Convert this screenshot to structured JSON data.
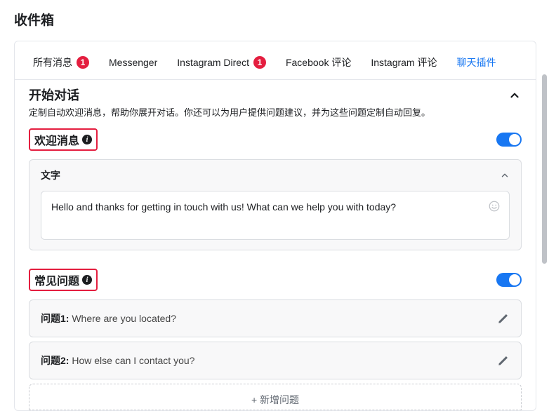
{
  "page_title": "收件箱",
  "tabs": [
    {
      "label": "所有消息",
      "badge": "1"
    },
    {
      "label": "Messenger"
    },
    {
      "label": "Instagram Direct",
      "badge": "1"
    },
    {
      "label": "Facebook 评论"
    },
    {
      "label": "Instagram 评论"
    },
    {
      "label": "聊天插件",
      "active": true
    }
  ],
  "start": {
    "title": "开始对话",
    "desc": "定制自动欢迎消息，帮助你展开对话。你还可以为用户提供问题建议，并为这些问题定制自动回复。"
  },
  "welcome": {
    "title": "欢迎消息",
    "text_header": "文字",
    "message": "Hello and thanks for getting in touch with us! What can we help you with today?",
    "toggle_on": true
  },
  "faq": {
    "title": "常见问题",
    "toggle_on": true,
    "q1_label": "问题1: ",
    "q1_text": "Where are you located?",
    "q2_label": "问题2: ",
    "q2_text": "How else can I contact you?",
    "add_label": "+ 新增问题"
  }
}
